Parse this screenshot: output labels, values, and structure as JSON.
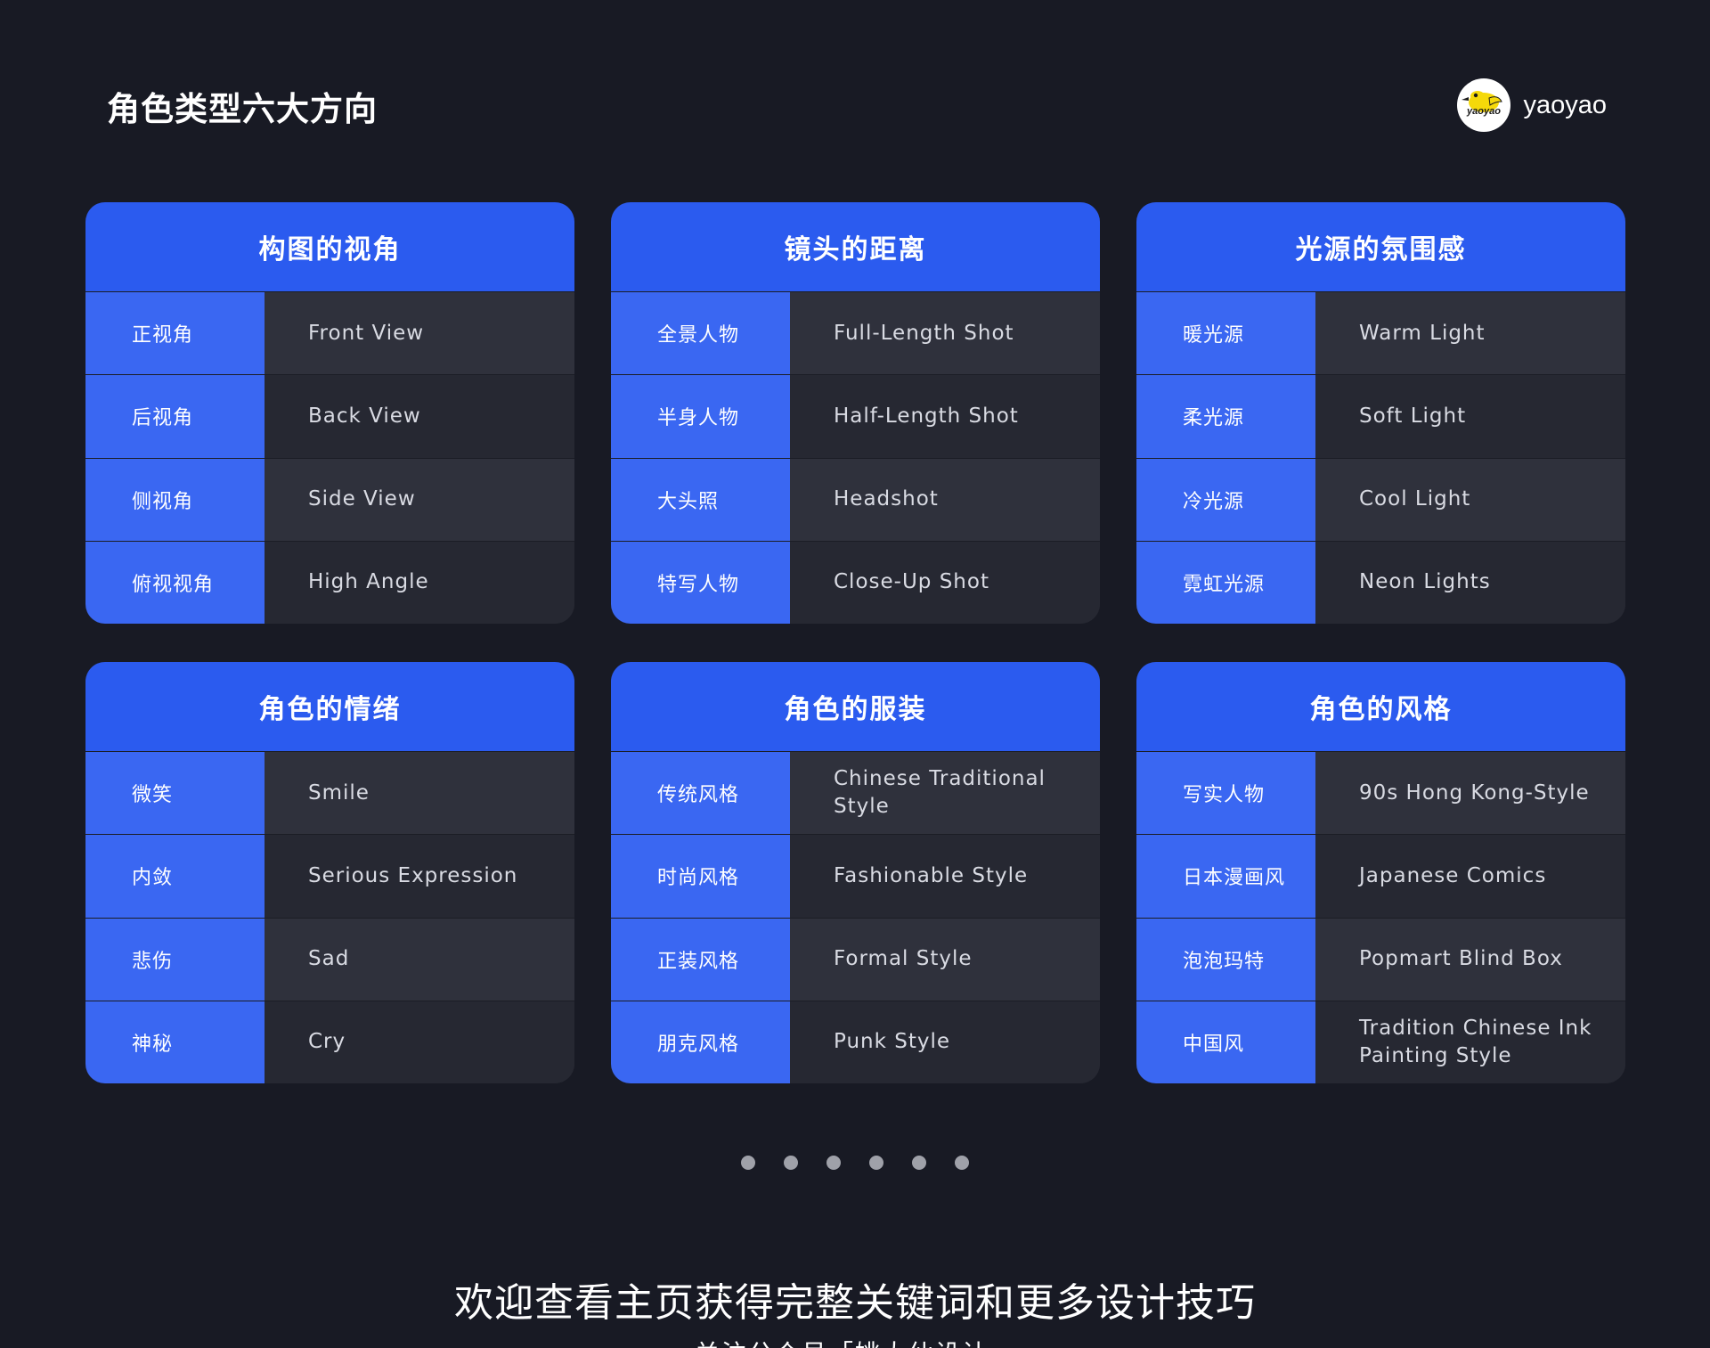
{
  "page": {
    "title": "角色类型六大方向",
    "brand_name": "yaoyao",
    "brand_logo_text": "yaoyao"
  },
  "cards": [
    {
      "title": "构图的视角",
      "rows": [
        {
          "label": "正视角",
          "value": "Front View"
        },
        {
          "label": "后视角",
          "value": "Back View"
        },
        {
          "label": "侧视角",
          "value": "Side View"
        },
        {
          "label": "俯视视角",
          "value": "High Angle"
        }
      ]
    },
    {
      "title": "镜头的距离",
      "rows": [
        {
          "label": "全景人物",
          "value": "Full-Length Shot"
        },
        {
          "label": "半身人物",
          "value": "Half-Length Shot"
        },
        {
          "label": "大头照",
          "value": "Headshot"
        },
        {
          "label": "特写人物",
          "value": "Close-Up Shot"
        }
      ]
    },
    {
      "title": "光源的氛围感",
      "rows": [
        {
          "label": "暖光源",
          "value": "Warm Light"
        },
        {
          "label": "柔光源",
          "value": "Soft Light"
        },
        {
          "label": "冷光源",
          "value": "Cool Light"
        },
        {
          "label": "霓虹光源",
          "value": "Neon Lights"
        }
      ]
    },
    {
      "title": "角色的情绪",
      "rows": [
        {
          "label": "微笑",
          "value": "Smile"
        },
        {
          "label": "内敛",
          "value": "Serious Expression"
        },
        {
          "label": "悲伤",
          "value": "Sad"
        },
        {
          "label": "神秘",
          "value": "Cry"
        }
      ]
    },
    {
      "title": "角色的服装",
      "rows": [
        {
          "label": "传统风格",
          "value": "Chinese Traditional Style"
        },
        {
          "label": "时尚风格",
          "value": "Fashionable Style"
        },
        {
          "label": "正装风格",
          "value": "Formal Style"
        },
        {
          "label": "朋克风格",
          "value": "Punk Style"
        }
      ]
    },
    {
      "title": "角色的风格",
      "rows": [
        {
          "label": "写实人物",
          "value": "90s Hong Kong-Style"
        },
        {
          "label": "日本漫画风",
          "value": "Japanese Comics"
        },
        {
          "label": "泡泡玛特",
          "value": "Popmart Blind Box"
        },
        {
          "label": "中国风",
          "value": "Tradition Chinese Ink Painting Style"
        }
      ]
    }
  ],
  "footer": {
    "main": "欢迎查看主页获得完整关键词和更多设计技巧",
    "sub": "关注公众号「姚大仙设计」"
  },
  "colors": {
    "background": "#181a24",
    "accent": "#2b5bef",
    "label_bg": "#3a67f2",
    "row_bg": "#262832",
    "row_bg_alt": "#2f313c"
  },
  "pager_count": 6
}
